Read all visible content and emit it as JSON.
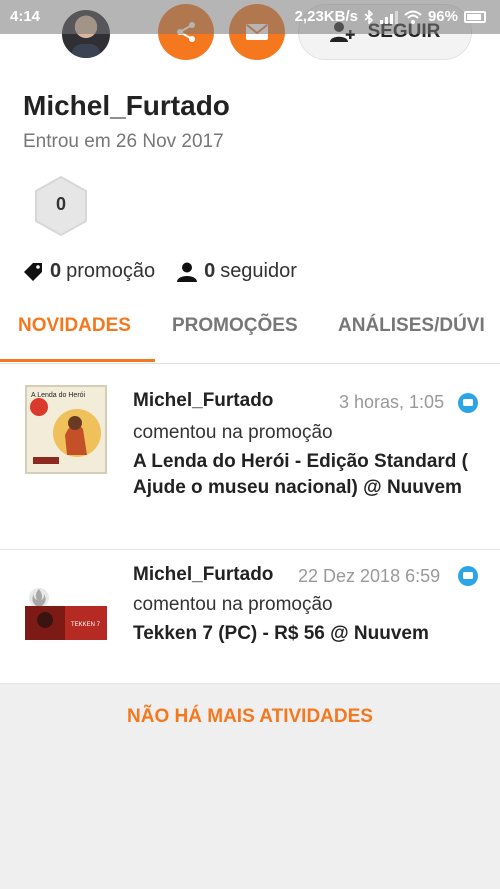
{
  "status_bar": {
    "time": "4:14",
    "network": "2,23KB/s",
    "battery": "96%"
  },
  "profile": {
    "username": "Michel_Furtado",
    "joined": "Entrou em 26 Nov 2017",
    "badge_value": "0",
    "follow_label": "SEGUIR",
    "stats": {
      "promotions_count": "0",
      "promotions_label": "promoção",
      "followers_count": "0",
      "followers_label": "seguidor"
    }
  },
  "tabs": [
    {
      "label": "NOVIDADES",
      "active": true
    },
    {
      "label": "PROMOÇÕES",
      "active": false
    },
    {
      "label": "ANÁLISES/DÚVI",
      "active": false
    }
  ],
  "feed": [
    {
      "name": "Michel_Furtado",
      "time": "3 horas, 1:05",
      "action": "comentou na promoção",
      "title": "A Lenda do Herói - Edição Standard ( Ajude o museu nacional) @ Nuuvem",
      "thumb_text": "A Lenda do Herói"
    },
    {
      "name": "Michel_Furtado",
      "time": "22 Dez 2018 6:59",
      "action": "comentou na promoção",
      "title": "Tekken 7 (PC) - R$ 56 @ Nuuvem",
      "thumb_text": "TEKKEN 7"
    }
  ],
  "footer": {
    "no_more": "NÃO HÁ MAIS ATIVIDADES"
  },
  "colors": {
    "accent": "#f5781f",
    "chat_bubble": "#2aa6e6",
    "background": "#efefef"
  }
}
